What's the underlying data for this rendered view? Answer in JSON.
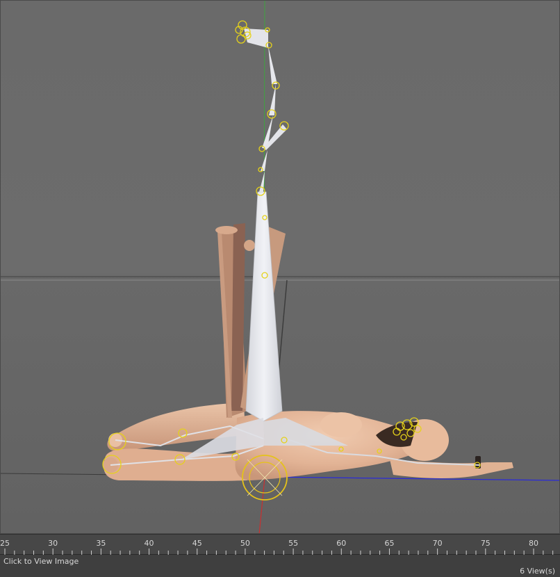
{
  "viewport": {
    "accent_colors": {
      "y_axis": "#3fa33f",
      "x_axis": "#2a2ad8",
      "z_axis": "#c83030",
      "bone_fill": "#e8e8ec",
      "joint_ring": "#e5d21a",
      "skin": "#e7bb9c"
    },
    "scene_objects": [
      "reclining-figure",
      "bone-rig",
      "hanging-limb",
      "ground-plane",
      "rotation-gizmo"
    ]
  },
  "timeline": {
    "ticks": [
      25,
      30,
      35,
      40,
      45,
      50,
      55,
      60,
      65,
      70,
      75,
      80
    ]
  },
  "status": {
    "hint": "Click to View Image",
    "views": "6 View(s)"
  }
}
